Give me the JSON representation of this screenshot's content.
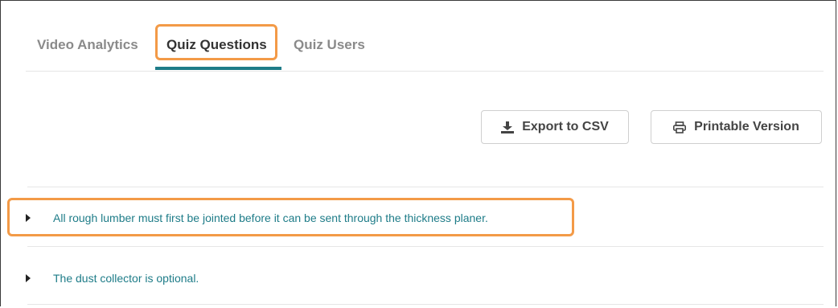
{
  "tabs": [
    {
      "label": "Video Analytics",
      "active": false
    },
    {
      "label": "Quiz Questions",
      "active": true
    },
    {
      "label": "Quiz Users",
      "active": false
    }
  ],
  "toolbar": {
    "export_label": "Export to CSV",
    "export_icon": "download-icon",
    "print_label": "Printable Version",
    "print_icon": "printer-icon"
  },
  "questions": [
    {
      "text": "All rough lumber must first be jointed before it can be sent through the thickness planer.",
      "expanded": false
    },
    {
      "text": "The dust collector is optional.",
      "expanded": false
    }
  ],
  "colors": {
    "accent": "#1e7c88",
    "highlight": "#f39a47",
    "tab_inactive": "#8a8a8a",
    "tab_active": "#333333"
  }
}
